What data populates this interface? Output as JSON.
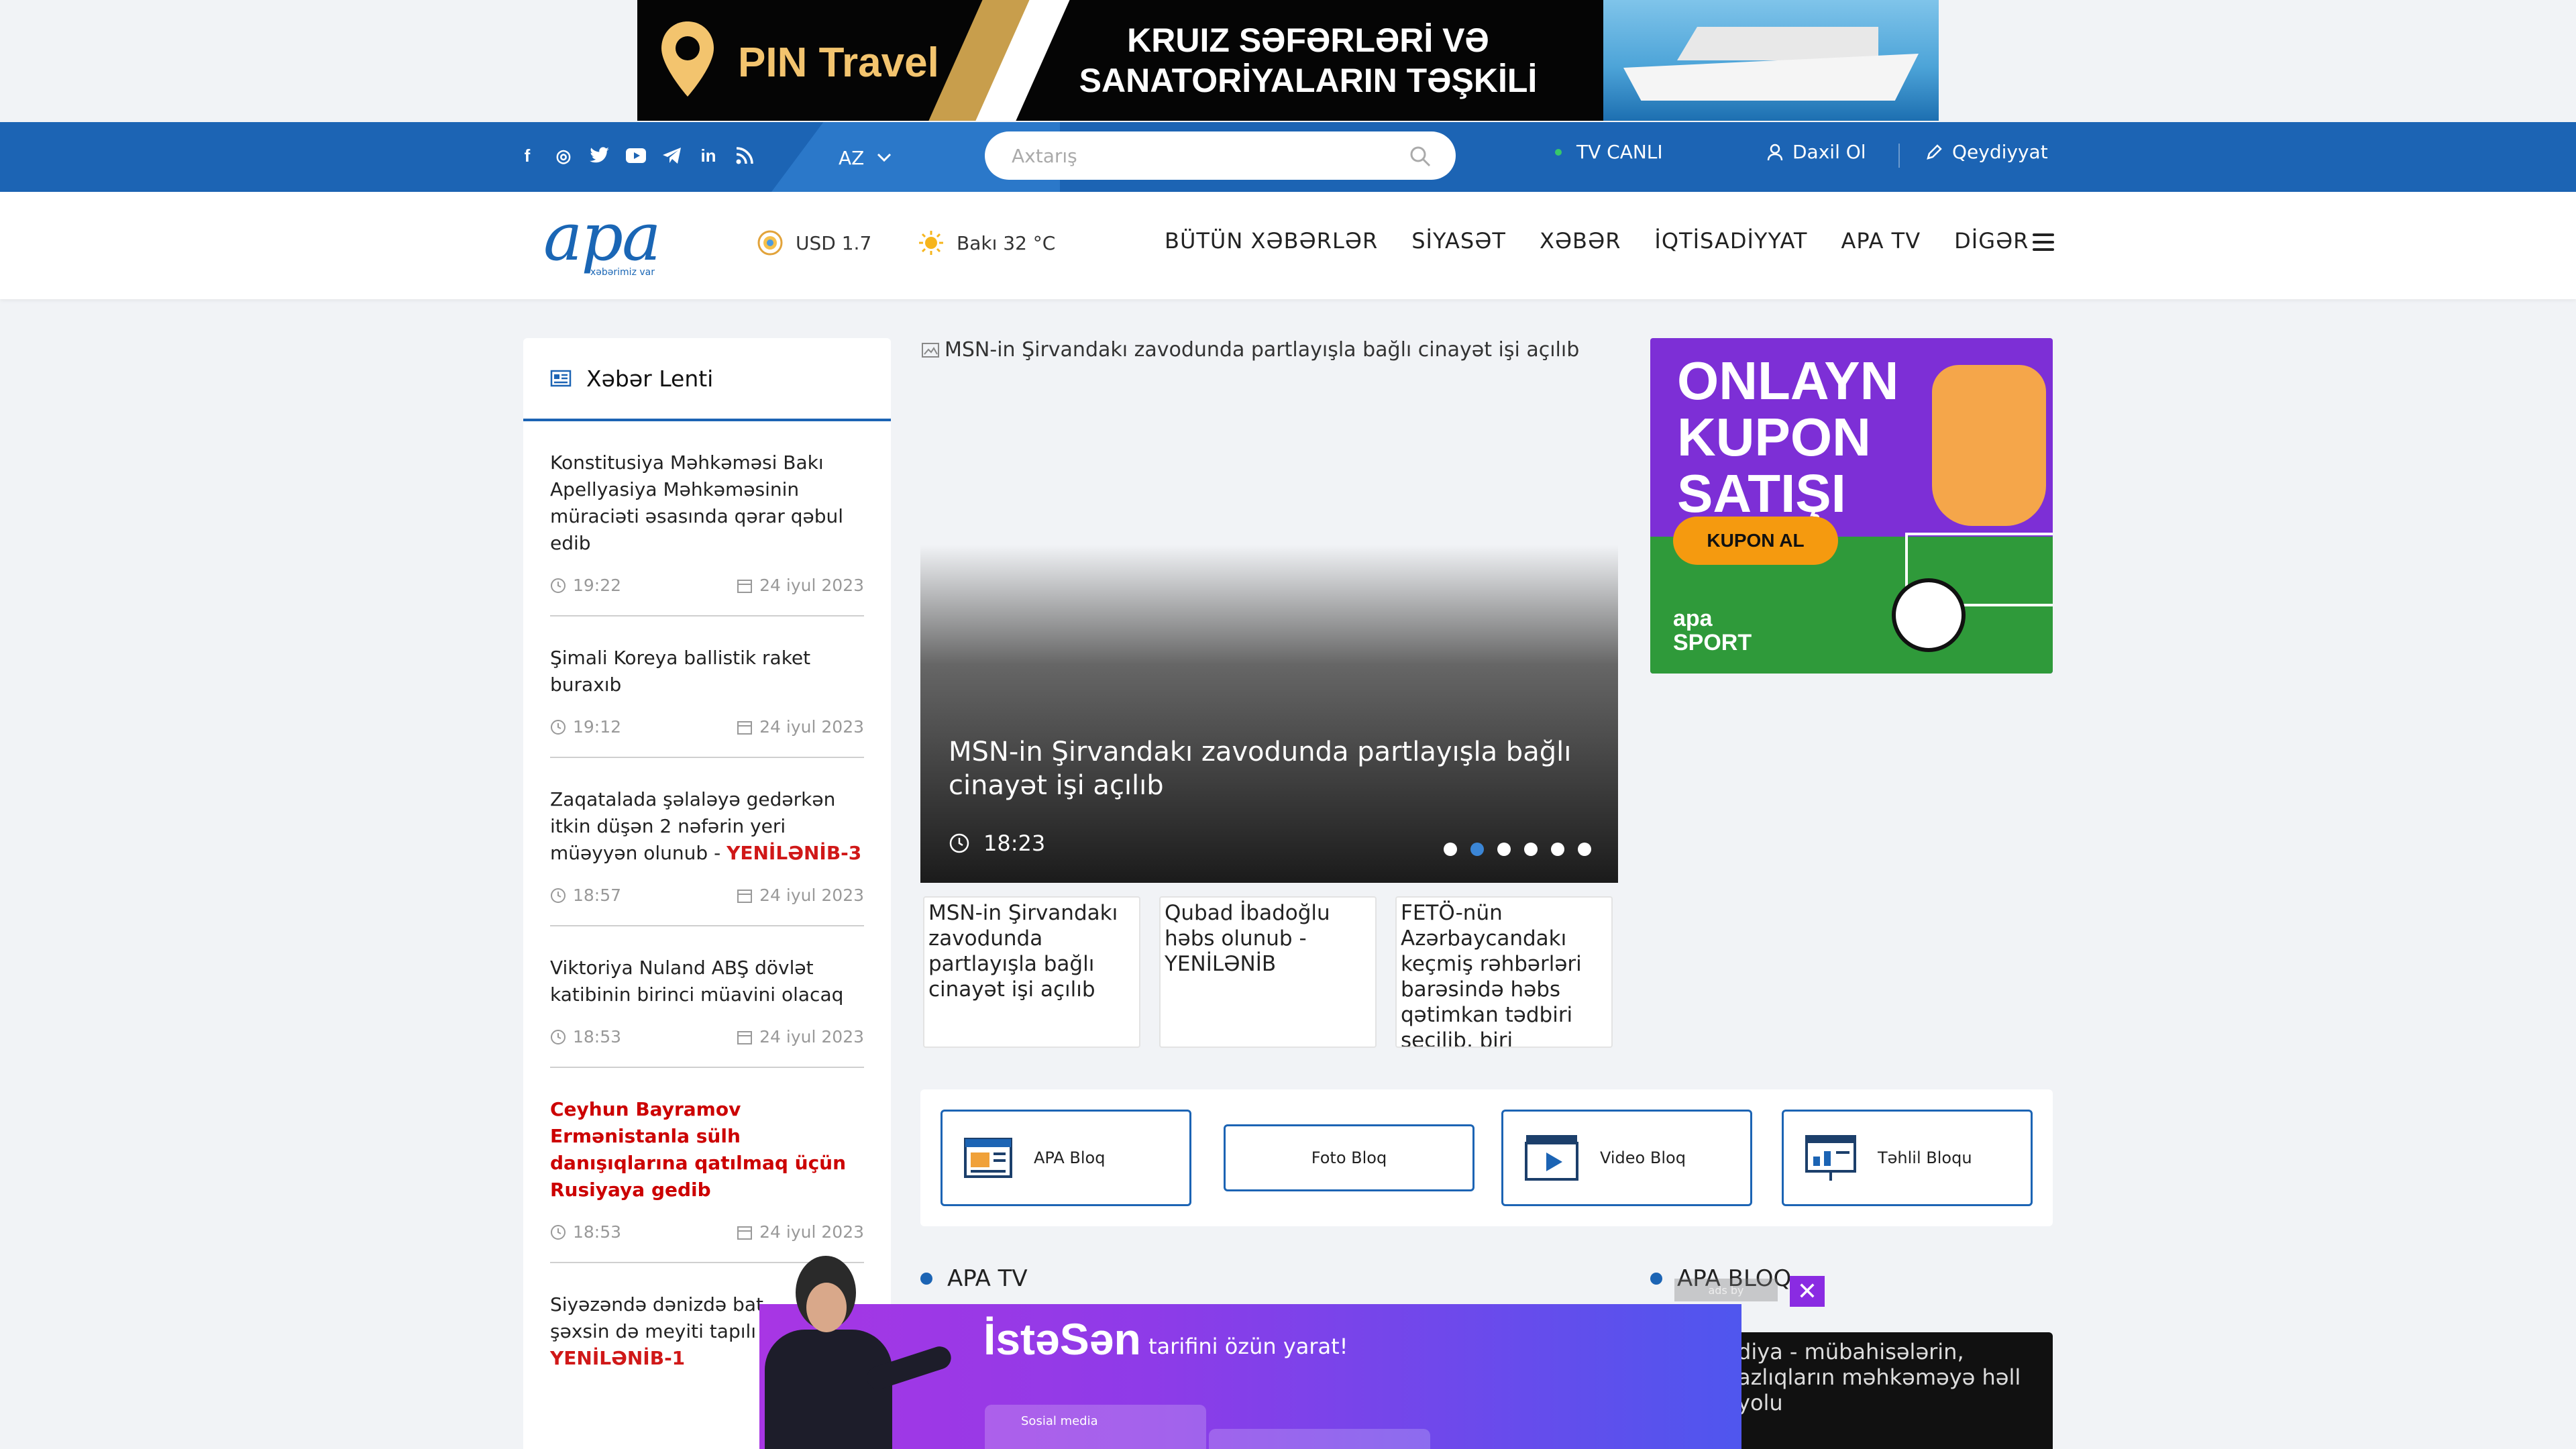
{
  "ad_top": {
    "brand": "PIN Travel",
    "headline_line1": "KRUIZ SƏFƏRLƏRİ VƏ",
    "headline_line2": "SANATORİYALARIN TƏŞKİLİ"
  },
  "topbar": {
    "social": [
      {
        "icon": "facebook-icon",
        "glyph": "f"
      },
      {
        "icon": "instagram-icon",
        "glyph": "◎"
      },
      {
        "icon": "twitter-icon",
        "glyph": "🐦"
      },
      {
        "icon": "youtube-icon",
        "glyph": "▶"
      },
      {
        "icon": "telegram-icon",
        "glyph": "➤"
      },
      {
        "icon": "linkedin-icon",
        "glyph": "in"
      },
      {
        "icon": "rss-icon",
        "glyph": "◥"
      }
    ],
    "language": "AZ",
    "search_placeholder": "Axtarış",
    "tv_live": "TV CANLI",
    "login": "Daxil Ol",
    "register": "Qeydiyyat"
  },
  "header": {
    "logo_word": "apa",
    "logo_tagline": "xəbərimiz var",
    "usd": "USD 1.7",
    "weather": "Bakı 32 °C",
    "nav": [
      "BÜTÜN XƏBƏRLƏR",
      "SİYASƏT",
      "XƏBƏR",
      "İQTİSADİYYAT",
      "APA TV",
      "DİGƏR"
    ]
  },
  "feed": {
    "title": "Xəbər Lenti",
    "items": [
      {
        "title": "Konstitusiya Məhkəməsi Bakı Apellyasiya Məhkəməsinin müraciəti əsasında qərar qəbul edib",
        "suffix": "",
        "time": "19:22",
        "date": "24 iyul 2023"
      },
      {
        "title": "Şimali Koreya ballistik raket buraxıb",
        "suffix": "",
        "time": "19:12",
        "date": "24 iyul 2023"
      },
      {
        "title": "Zaqatalada şəlaləyə gedərkən itkin düşən 2 nəfərin yeri müəyyən olunub - ",
        "suffix": "YENİLƏNİB-3",
        "time": "18:57",
        "date": "24 iyul 2023"
      },
      {
        "title": "Viktoriya Nuland ABŞ dövlət katibinin birinci müavini olacaq",
        "suffix": "",
        "time": "18:53",
        "date": "24 iyul 2023"
      },
      {
        "title": "Ceyhun Bayramov Ermənistanla sülh danışıqlarına qatılmaq üçün Rusiyaya gedib",
        "suffix": "",
        "time": "18:53",
        "date": "24 iyul 2023"
      },
      {
        "title": "Siyəzəndə dənizdə bat",
        "suffix": "YENİLƏNİB-1",
        "time": "",
        "date": ""
      }
    ],
    "last_item_line2": "şəxsin də meyiti tapılı"
  },
  "slider": {
    "alt": "MSN-in Şirvandakı zavodunda partlayışla bağlı cinayət işi açılıb",
    "caption": "MSN-in Şirvandakı zavodunda partlayışla bağlı cinayət işi açılıb",
    "time": "18:23",
    "dots": 6,
    "active_dot": 1
  },
  "thumbs": [
    "MSN-in Şirvandakı zavodunda partlayışla bağlı cinayət işi açılıb",
    "Qubad İbadoğlu həbs olunub - YENİLƏNİB",
    "FETÖ-nün Azərbaycandakı keçmiş rəhbərləri barəsində həbs qətimkan tədbiri seçilib, biri"
  ],
  "blogs": {
    "apa": "APA Bloq",
    "foto": "Foto Bloq",
    "video": "Video Bloq",
    "tahlil": "Təhlil Bloqu"
  },
  "ad_right": {
    "line1": "ONLAYN",
    "line2": "KUPON",
    "line3": "SATIŞI",
    "button": "KUPON AL",
    "brand1": "apa",
    "brand2": "SPORT"
  },
  "sections": {
    "tv": "APA TV",
    "blog": "APA BLOQ"
  },
  "blog_teaser": "diya - mübahisələrin, azlıqların məhkəməyə həll yolu",
  "popup": {
    "brand": "İstəSən",
    "sub": "tarifini özün yarat!",
    "card": "Sosial media",
    "adby": "ads by",
    "close": "✕"
  },
  "colors": {
    "primary": "#1c64b4",
    "breaking": "#c00000",
    "popup": "#8e3be8"
  }
}
